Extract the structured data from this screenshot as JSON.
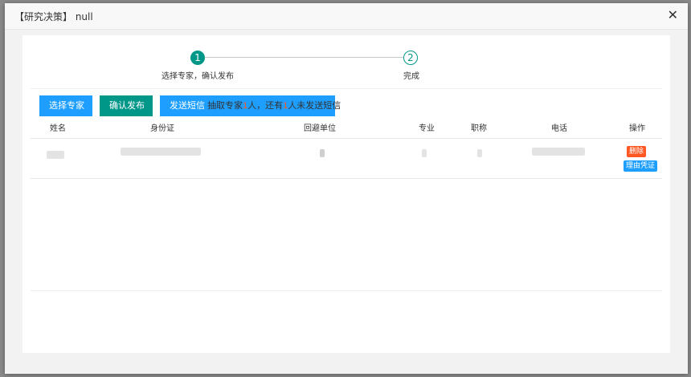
{
  "window": {
    "title": "【研究决策】 null",
    "close_glyph": "✕"
  },
  "stepper": {
    "steps": [
      {
        "number": "1",
        "label": "选择专家，确认发布",
        "active": true
      },
      {
        "number": "2",
        "label": "完成",
        "active": false
      }
    ],
    "active_color": "#009688"
  },
  "toolbar": {
    "select_expert_label": "选择专家",
    "confirm_publish_label": "确认发布",
    "sms_label": "发送短信",
    "sms_hint_prefix": "抽取专家",
    "sms_hint_count1": "1",
    "sms_hint_middle": "人，还有",
    "sms_hint_count2": "1",
    "sms_hint_suffix": "人未发送短信"
  },
  "table": {
    "headers": [
      "姓名",
      "身份证",
      "回避单位",
      "专业",
      "职称",
      "电话",
      "操作"
    ],
    "row_actions": {
      "delete_label": "删除",
      "proof_label": "理由凭证"
    }
  },
  "colors": {
    "primary_blue": "#1E9FFF",
    "teal": "#009688",
    "danger": "#FF5722"
  }
}
